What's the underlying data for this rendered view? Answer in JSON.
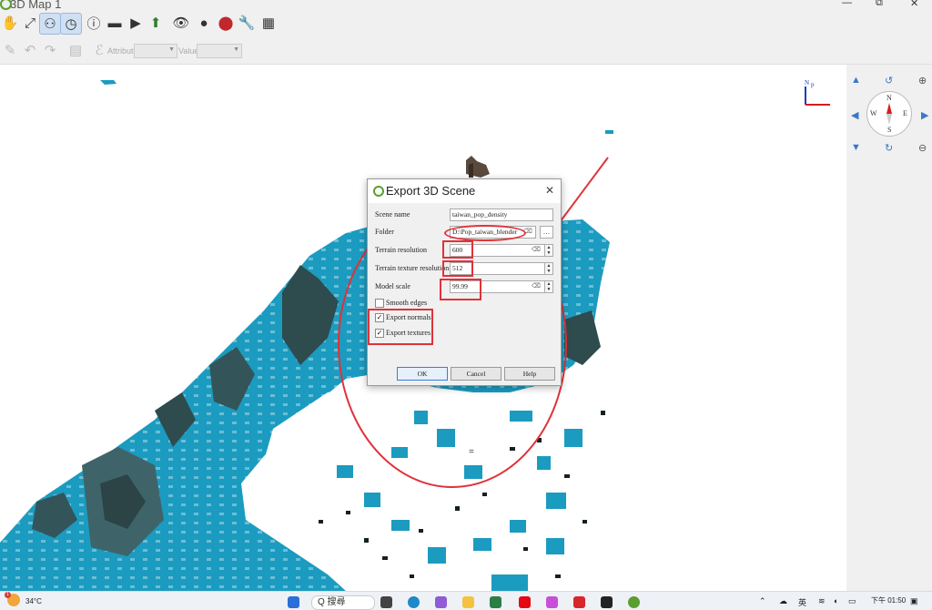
{
  "window": {
    "title": "3D Map 1",
    "minimize": "—",
    "restore": "⧉",
    "close": "✕"
  },
  "toolbar2": {
    "attribute_label": "Attribute",
    "value_label": "Value"
  },
  "map": {
    "axis_label_n": "N",
    "axis_label_p": "p",
    "compass": {
      "n": "N",
      "s": "S",
      "e": "E",
      "w": "W"
    },
    "center_marker": "="
  },
  "dialog": {
    "title": "Export 3D Scene",
    "close_glyph": "✕",
    "fields": {
      "scene_name_label": "Scene name",
      "scene_name_value": "taiwan_pop_density",
      "folder_label": "Folder",
      "folder_value": "D:\\Pop_taiwan_blender",
      "folder_browse": "…",
      "terrain_resolution_label": "Terrain resolution",
      "terrain_resolution_value": "600",
      "terrain_texture_label": "Terrain texture resolution",
      "terrain_texture_value": "512",
      "model_scale_label": "Model scale",
      "model_scale_value": "99.99"
    },
    "checkboxes": [
      {
        "label": "Smooth edges",
        "checked": false
      },
      {
        "label": "Export normals",
        "checked": true
      },
      {
        "label": "Export textures",
        "checked": true
      }
    ],
    "buttons": {
      "ok": "OK",
      "cancel": "Cancel",
      "help": "Help"
    }
  },
  "annotation_color": "#e0323a",
  "terrain_color": "#1b9bc0",
  "taskbar": {
    "weather_temp": "34°C",
    "weather_badge": "1",
    "search": "Q 搜尋",
    "ime": "英",
    "time": "下午 01:50"
  }
}
